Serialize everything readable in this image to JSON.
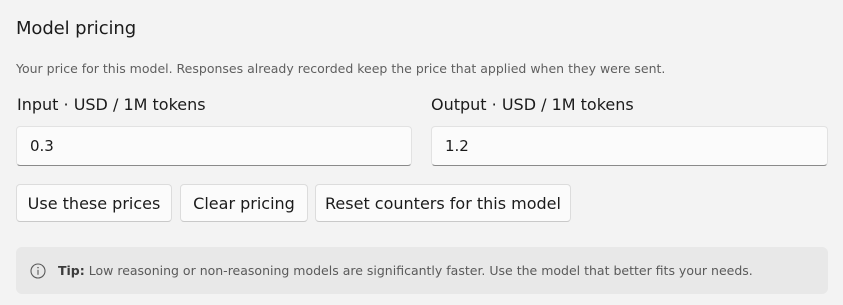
{
  "section": {
    "title": "Model pricing",
    "description": "Your price for this model. Responses already recorded keep the price that applied when they were sent."
  },
  "fields": {
    "input": {
      "label": "Input · USD / 1M tokens",
      "value": "0.3"
    },
    "output": {
      "label": "Output · USD / 1M tokens",
      "value": "1.2"
    }
  },
  "actions": {
    "use_prices": "Use these prices",
    "clear_pricing": "Clear pricing",
    "reset_counters": "Reset counters for this model"
  },
  "tip": {
    "icon": "info-icon",
    "label": "Tip:",
    "text": " Low reasoning or non-reasoning models are significantly faster. Use the model that better fits your needs."
  },
  "colors": {
    "background": "#f3f3f3",
    "tip_background": "#e8e8e8",
    "input_background": "#fbfbfb"
  }
}
